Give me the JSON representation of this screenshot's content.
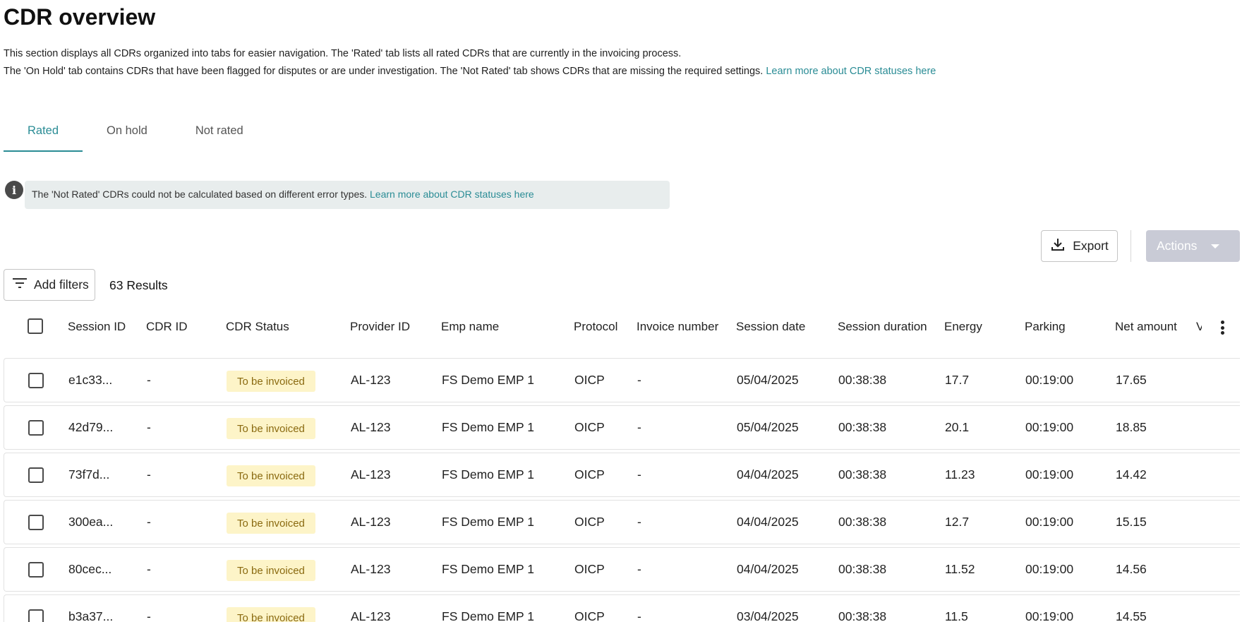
{
  "page": {
    "title": "CDR overview",
    "description_line1": "This section displays all CDRs organized into tabs for easier navigation. The 'Rated' tab lists all rated CDRs that are currently in the invoicing process.",
    "description_line2": "The 'On Hold' tab contains CDRs that have been flagged for disputes or are under investigation. The 'Not Rated' tab shows CDRs that are missing the required settings.",
    "learn_more_link": "Learn more about CDR statuses here"
  },
  "tabs": [
    {
      "label": "Rated",
      "active": true
    },
    {
      "label": "On hold",
      "active": false
    },
    {
      "label": "Not rated",
      "active": false
    }
  ],
  "info_banner": {
    "text": "The 'Not Rated' CDRs could not be calculated based on different error types.",
    "link": "Learn more about CDR statuses here",
    "icon": "info-icon"
  },
  "toolbar": {
    "export_label": "Export",
    "actions_label": "Actions",
    "add_filters_label": "Add filters",
    "results_label": "63 Results"
  },
  "table": {
    "columns": [
      "Session ID",
      "CDR ID",
      "CDR Status",
      "Provider ID",
      "Emp name",
      "Protocol",
      "Invoice number",
      "Session date",
      "Session duration",
      "Energy",
      "Parking",
      "Net amount",
      "V"
    ],
    "rows": [
      {
        "session_id": "e1c33...",
        "cdr_id": "-",
        "status": "To be invoiced",
        "provider_id": "AL-123",
        "emp_name": "FS Demo EMP 1",
        "protocol": "OICP",
        "invoice_number": "-",
        "session_date": "05/04/2025",
        "session_duration": "00:38:38",
        "energy": "17.7",
        "parking": "00:19:00",
        "net_amount": "17.65"
      },
      {
        "session_id": "42d79...",
        "cdr_id": "-",
        "status": "To be invoiced",
        "provider_id": "AL-123",
        "emp_name": "FS Demo EMP 1",
        "protocol": "OICP",
        "invoice_number": "-",
        "session_date": "05/04/2025",
        "session_duration": "00:38:38",
        "energy": "20.1",
        "parking": "00:19:00",
        "net_amount": "18.85"
      },
      {
        "session_id": "73f7d...",
        "cdr_id": "-",
        "status": "To be invoiced",
        "provider_id": "AL-123",
        "emp_name": "FS Demo EMP 1",
        "protocol": "OICP",
        "invoice_number": "-",
        "session_date": "04/04/2025",
        "session_duration": "00:38:38",
        "energy": "11.23",
        "parking": "00:19:00",
        "net_amount": "14.42"
      },
      {
        "session_id": "300ea...",
        "cdr_id": "-",
        "status": "To be invoiced",
        "provider_id": "AL-123",
        "emp_name": "FS Demo EMP 1",
        "protocol": "OICP",
        "invoice_number": "-",
        "session_date": "04/04/2025",
        "session_duration": "00:38:38",
        "energy": "12.7",
        "parking": "00:19:00",
        "net_amount": "15.15"
      },
      {
        "session_id": "80cec...",
        "cdr_id": "-",
        "status": "To be invoiced",
        "provider_id": "AL-123",
        "emp_name": "FS Demo EMP 1",
        "protocol": "OICP",
        "invoice_number": "-",
        "session_date": "04/04/2025",
        "session_duration": "00:38:38",
        "energy": "11.52",
        "parking": "00:19:00",
        "net_amount": "14.56"
      },
      {
        "session_id": "b3a37...",
        "cdr_id": "-",
        "status": "To be invoiced",
        "provider_id": "AL-123",
        "emp_name": "FS Demo EMP 1",
        "protocol": "OICP",
        "invoice_number": "-",
        "session_date": "03/04/2025",
        "session_duration": "00:38:38",
        "energy": "11.5",
        "parking": "00:19:00",
        "net_amount": "14.55"
      }
    ]
  },
  "colors": {
    "accent": "#2a8c95",
    "badge_bg": "#fdf4c8",
    "badge_text": "#8a6a10",
    "actions_disabled": "#c9cbd6"
  }
}
